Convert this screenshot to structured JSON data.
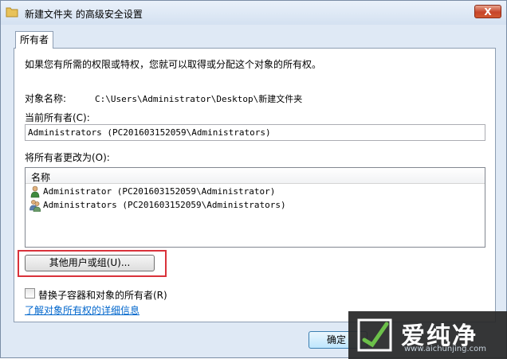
{
  "window": {
    "title": "新建文件夹 的高级安全设置",
    "close_label": "X"
  },
  "tab": {
    "label": "所有者"
  },
  "content": {
    "intro": "如果您有所需的权限或特权，您就可以取得或分配这个对象的所有权。",
    "object_name_label": "对象名称:",
    "object_name_value": "C:\\Users\\Administrator\\Desktop\\新建文件夹",
    "current_owner_label": "当前所有者(C):",
    "current_owner_value": "Administrators (PC201603152059\\Administrators)",
    "change_owner_label": "将所有者更改为(O):",
    "list_header": "名称",
    "list_items": [
      {
        "label": "Administrator (PC201603152059\\Administrator)",
        "icon": "user-icon"
      },
      {
        "label": "Administrators (PC201603152059\\Administrators)",
        "icon": "group-icon"
      }
    ],
    "other_users_button": "其他用户或组(U)...",
    "replace_checkbox_label": "替换子容器和对象的所有者(R)",
    "replace_checked": false,
    "learn_more_link": "了解对象所有权的详细信息"
  },
  "footer": {
    "ok_button": "确定"
  },
  "watermark": {
    "brand": "爱纯净",
    "url": "www.aichunjing.com"
  },
  "colors": {
    "highlight": "#d9323a",
    "link": "#0066cc",
    "close": "#c7452a"
  }
}
